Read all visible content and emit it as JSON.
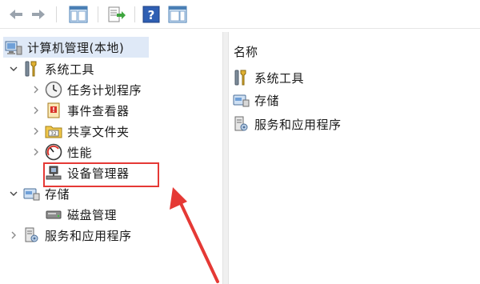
{
  "toolbar": {
    "buttons": [
      {
        "name": "back-icon"
      },
      {
        "name": "forward-icon"
      },
      {
        "name": "show-hide-tree-icon"
      },
      {
        "name": "export-list-icon"
      },
      {
        "name": "help-icon"
      },
      {
        "name": "action-pane-icon"
      }
    ]
  },
  "tree": {
    "root": {
      "label": "计算机管理(本地)",
      "icon": "computer-management-icon"
    },
    "system_tools": {
      "label": "系统工具",
      "icon": "tools-icon"
    },
    "task_scheduler": {
      "label": "任务计划程序",
      "icon": "clock-icon"
    },
    "event_viewer": {
      "label": "事件查看器",
      "icon": "event-viewer-icon"
    },
    "shared_folders": {
      "label": "共享文件夹",
      "icon": "shared-folder-icon"
    },
    "performance": {
      "label": "性能",
      "icon": "performance-icon"
    },
    "device_manager": {
      "label": "设备管理器",
      "icon": "device-manager-icon"
    },
    "storage": {
      "label": "存储",
      "icon": "storage-icon"
    },
    "disk_management": {
      "label": "磁盘管理",
      "icon": "disk-icon"
    },
    "services_apps": {
      "label": "服务和应用程序",
      "icon": "services-icon"
    }
  },
  "list": {
    "column_header": "名称",
    "items": [
      {
        "label": "系统工具",
        "icon": "tools-icon"
      },
      {
        "label": "存储",
        "icon": "storage-icon"
      },
      {
        "label": "服务和应用程序",
        "icon": "services-icon"
      }
    ]
  },
  "annotation": {
    "highlight_color": "#e53935",
    "arrow_color": "#e53935"
  }
}
